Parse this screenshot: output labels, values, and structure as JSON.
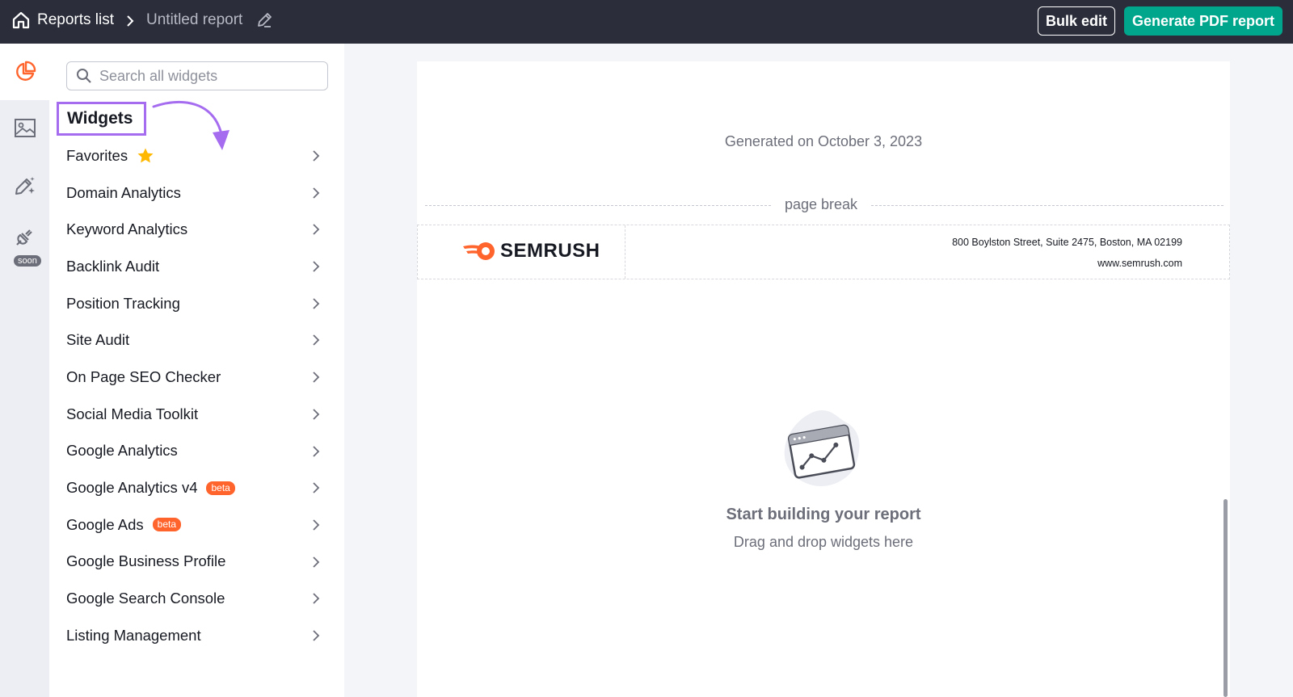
{
  "topbar": {
    "home_icon": "home-icon",
    "reports_list": "Reports list",
    "report_title": "Untitled report",
    "bulk_edit": "Bulk edit",
    "generate_pdf": "Generate PDF report"
  },
  "rail": {
    "items": [
      {
        "icon": "pie-chart-icon",
        "active": true
      },
      {
        "icon": "image-icon"
      },
      {
        "icon": "magic-pen-icon"
      },
      {
        "icon": "plug-icon",
        "badge": "soon"
      }
    ]
  },
  "panel": {
    "search_placeholder": "Search all widgets",
    "heading": "Widgets",
    "items": [
      {
        "label": "Favorites",
        "icon": "star-icon"
      },
      {
        "label": "Domain Analytics"
      },
      {
        "label": "Keyword Analytics"
      },
      {
        "label": "Backlink Audit"
      },
      {
        "label": "Position Tracking"
      },
      {
        "label": "Site Audit"
      },
      {
        "label": "On Page SEO Checker"
      },
      {
        "label": "Social Media Toolkit"
      },
      {
        "label": "Google Analytics"
      },
      {
        "label": "Google Analytics v4",
        "badge": "beta"
      },
      {
        "label": "Google Ads",
        "badge": "beta"
      },
      {
        "label": "Google Business Profile"
      },
      {
        "label": "Google Search Console"
      },
      {
        "label": "Listing Management"
      }
    ]
  },
  "canvas": {
    "generated": "Generated on October 3, 2023",
    "page_break": "page break",
    "logo_text": "SEMRUSH",
    "address": "800 Boylston Street, Suite 2475, Boston, MA 02199",
    "website": "www.semrush.com",
    "empty_title": "Start building your report",
    "empty_subtitle": "Drag and drop widgets here"
  },
  "colors": {
    "topbar": "#2b2e3a",
    "accent_green": "#00a68c",
    "brand_orange": "#ff642d",
    "highlight_purple": "#a56cf0"
  }
}
